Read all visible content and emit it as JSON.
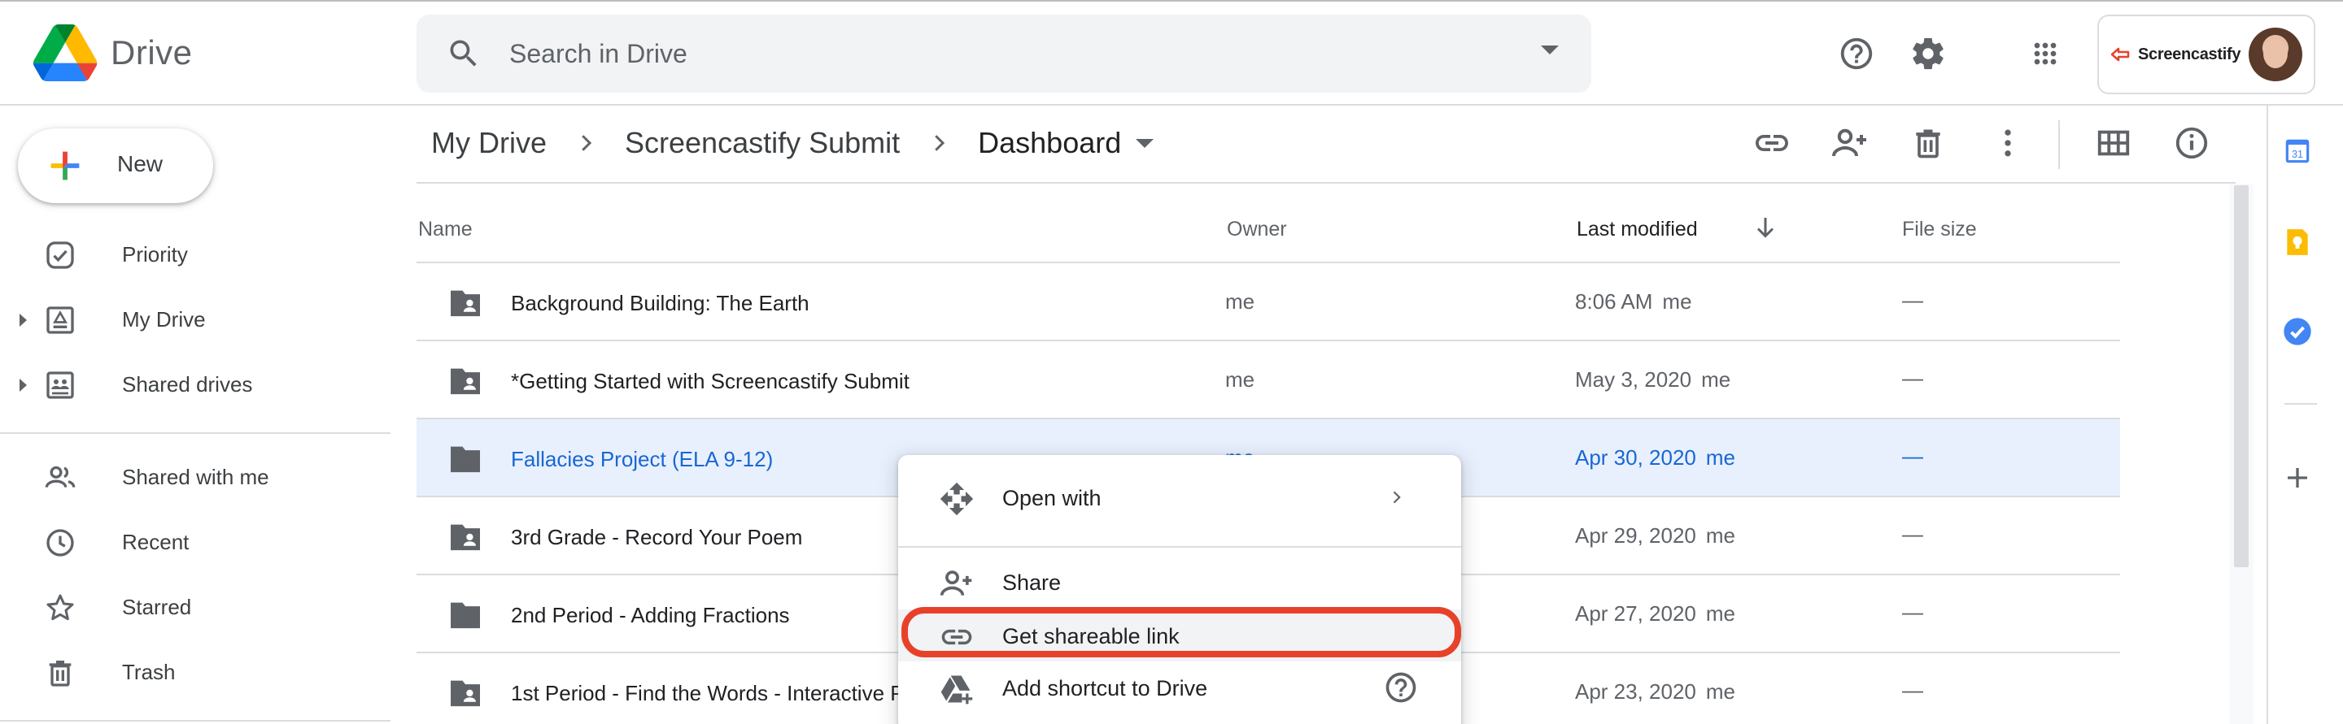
{
  "app": {
    "name": "Drive",
    "search_placeholder": "Search in Drive",
    "account_brand": "Screencastify"
  },
  "sidebar": {
    "new_label": "New",
    "items": [
      {
        "label": "Priority",
        "icon": "priority-icon"
      },
      {
        "label": "My Drive",
        "icon": "my-drive-icon"
      },
      {
        "label": "Shared drives",
        "icon": "shared-drives-icon"
      },
      {
        "label": "Shared with me",
        "icon": "shared-with-me-icon"
      },
      {
        "label": "Recent",
        "icon": "recent-icon"
      },
      {
        "label": "Starred",
        "icon": "star-icon"
      },
      {
        "label": "Trash",
        "icon": "trash-icon"
      }
    ]
  },
  "breadcrumb": [
    "My Drive",
    "Screencastify Submit",
    "Dashboard"
  ],
  "table": {
    "columns": [
      "Name",
      "Owner",
      "Last modified",
      "File size"
    ],
    "rows": [
      {
        "name": "Background Building: The Earth",
        "owner": "me",
        "modified": "8:06 AM",
        "by": "me",
        "size": "—",
        "shared": true
      },
      {
        "name": "*Getting Started with Screencastify Submit",
        "owner": "me",
        "modified": "May 3, 2020",
        "by": "me",
        "size": "—",
        "shared": true
      },
      {
        "name": "Fallacies Project (ELA 9-12)",
        "owner": "me",
        "modified": "Apr 30, 2020",
        "by": "me",
        "size": "—",
        "shared": false
      },
      {
        "name": "3rd Grade - Record Your Poem",
        "owner": "",
        "modified": "Apr 29, 2020",
        "by": "me",
        "size": "—",
        "shared": true
      },
      {
        "name": "2nd Period - Adding Fractions",
        "owner": "",
        "modified": "Apr 27, 2020",
        "by": "me",
        "size": "—",
        "shared": false
      },
      {
        "name": "1st Period - Find the Words - Interactive P",
        "owner": "",
        "modified": "Apr 23, 2020",
        "by": "me",
        "size": "—",
        "shared": true
      }
    ]
  },
  "context_menu": {
    "items": [
      "Open with",
      "Share",
      "Get shareable link",
      "Add shortcut to Drive"
    ]
  },
  "colors": {
    "selected_row": "#e8f0fe",
    "selected_text": "#1967d2",
    "highlight_ring": "#e8412a"
  }
}
